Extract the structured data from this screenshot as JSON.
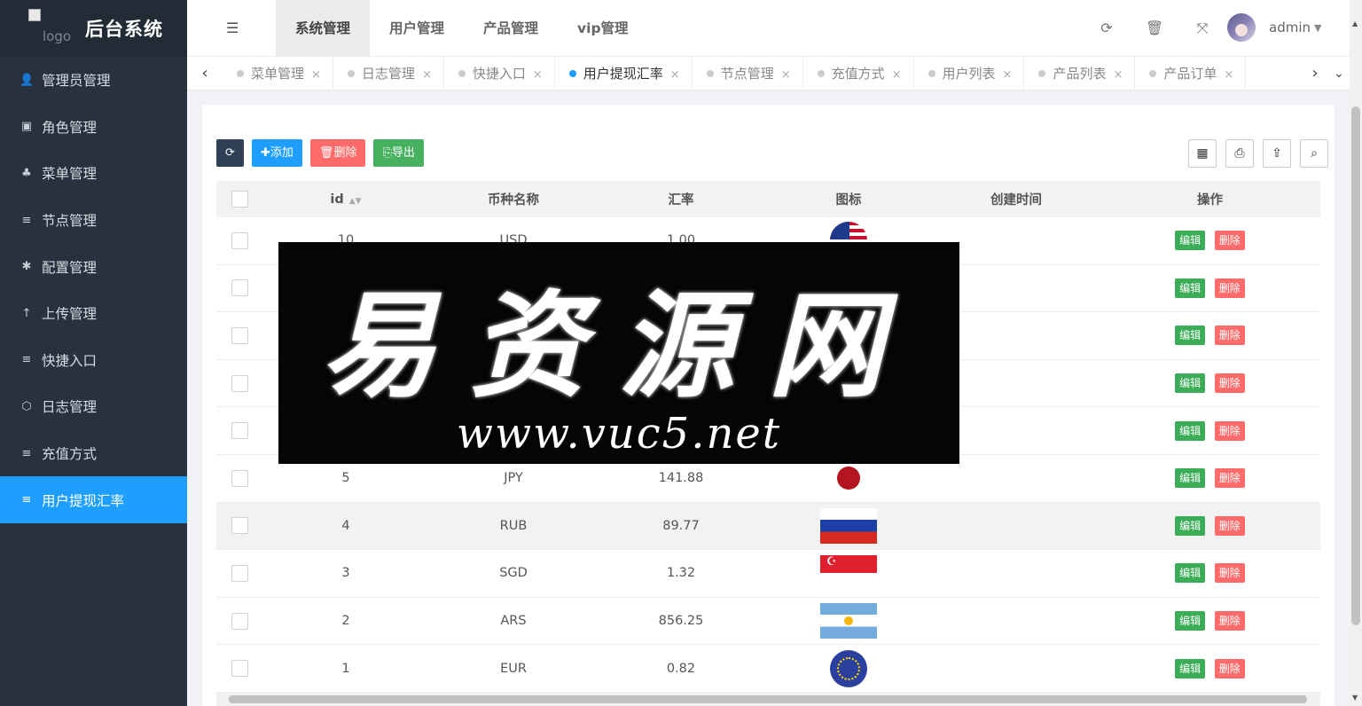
{
  "app": {
    "title": "后台系统",
    "logo_alt": "logo"
  },
  "sidebar": {
    "items": [
      {
        "label": "管理员管理",
        "icon": "user-icon"
      },
      {
        "label": "角色管理",
        "icon": "id-card-icon"
      },
      {
        "label": "菜单管理",
        "icon": "tree-icon"
      },
      {
        "label": "节点管理",
        "icon": "list-icon"
      },
      {
        "label": "配置管理",
        "icon": "gear-icon"
      },
      {
        "label": "上传管理",
        "icon": "arrow-up-icon"
      },
      {
        "label": "快捷入口",
        "icon": "list-icon"
      },
      {
        "label": "日志管理",
        "icon": "log-icon"
      },
      {
        "label": "充值方式",
        "icon": "list-icon"
      },
      {
        "label": "用户提现汇率",
        "icon": "list-icon",
        "active": true
      }
    ]
  },
  "header": {
    "tabs": [
      "系统管理",
      "用户管理",
      "产品管理",
      "vip管理"
    ],
    "active_tab": "系统管理",
    "user": "admin"
  },
  "page_tabs": [
    "菜单管理",
    "日志管理",
    "快捷入口",
    "用户提现汇率",
    "节点管理",
    "充值方式",
    "用户列表",
    "产品列表",
    "产品订单"
  ],
  "active_page_tab": "用户提现汇率",
  "toolbar": {
    "add": "添加",
    "delete": "删除",
    "export": "导出"
  },
  "table": {
    "columns": [
      "id",
      "币种名称",
      "汇率",
      "图标",
      "创建时间",
      "操作"
    ],
    "rows": [
      {
        "id": "10",
        "currency": "USD",
        "rate": "1.00",
        "flag": "us"
      },
      {
        "id": "",
        "currency": "",
        "rate": "",
        "flag": ""
      },
      {
        "id": "",
        "currency": "",
        "rate": "",
        "flag": ""
      },
      {
        "id": "",
        "currency": "",
        "rate": "",
        "flag": ""
      },
      {
        "id": "",
        "currency": "",
        "rate": "",
        "flag": ""
      },
      {
        "id": "5",
        "currency": "JPY",
        "rate": "141.88",
        "flag": "jp"
      },
      {
        "id": "4",
        "currency": "RUB",
        "rate": "89.77",
        "flag": "ru"
      },
      {
        "id": "3",
        "currency": "SGD",
        "rate": "1.32",
        "flag": "sg"
      },
      {
        "id": "2",
        "currency": "ARS",
        "rate": "856.25",
        "flag": "ar"
      },
      {
        "id": "1",
        "currency": "EUR",
        "rate": "0.82",
        "flag": "eu"
      }
    ],
    "edit_label": "编辑",
    "delete_label": "删除"
  },
  "watermark": {
    "title": "易资源网",
    "url": "www.vuc5.net"
  },
  "colors": {
    "sidebar_bg": "#28323f",
    "accent": "#1e9fff",
    "green": "#3aad56",
    "red": "#ff6b6b"
  }
}
